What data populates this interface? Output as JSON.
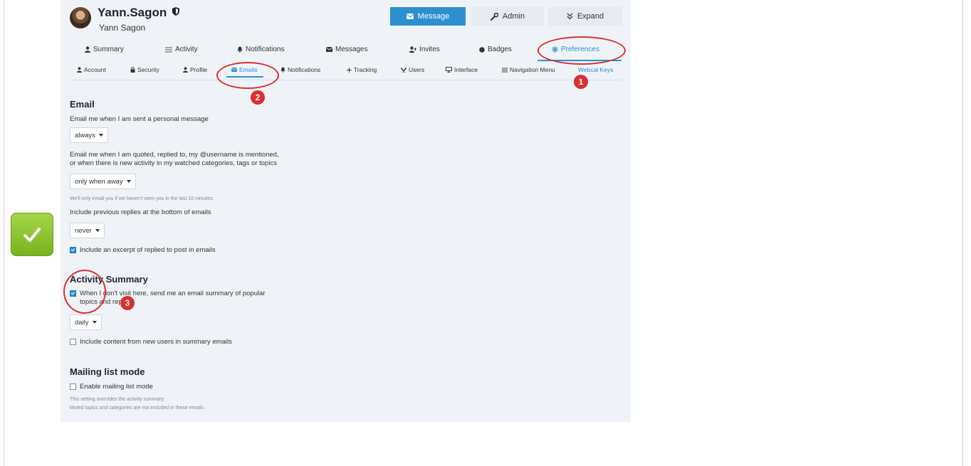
{
  "profile": {
    "username": "Yann.Sagon",
    "full_name": "Yann Sagon"
  },
  "header_buttons": {
    "message": "Message",
    "admin": "Admin",
    "expand": "Expand"
  },
  "tabs": [
    {
      "label": "Summary",
      "icon": "user-icon"
    },
    {
      "label": "Activity",
      "icon": "list-icon"
    },
    {
      "label": "Notifications",
      "icon": "bell-icon"
    },
    {
      "label": "Messages",
      "icon": "envelope-icon"
    },
    {
      "label": "Invites",
      "icon": "user-plus-icon"
    },
    {
      "label": "Badges",
      "icon": "badge-icon"
    },
    {
      "label": "Preferences",
      "icon": "gear-icon",
      "active": true
    }
  ],
  "subtabs": [
    {
      "label": "Account",
      "icon": "user-icon"
    },
    {
      "label": "Security",
      "icon": "lock-icon"
    },
    {
      "label": "Profile",
      "icon": "user-icon"
    },
    {
      "label": "Emails",
      "icon": "envelope-icon",
      "active": true
    },
    {
      "label": "Notifications",
      "icon": "bell-icon"
    },
    {
      "label": "Tracking",
      "icon": "plus-icon"
    },
    {
      "label": "Users",
      "icon": "users-icon"
    },
    {
      "label": "Interface",
      "icon": "desktop-icon"
    },
    {
      "label": "Navigation Menu",
      "icon": "bars-icon"
    },
    {
      "label": "Webcal Keys",
      "icon": ""
    }
  ],
  "email_section": {
    "title": "Email",
    "pm_label": "Email me when I am sent a personal message",
    "pm_value": "always",
    "activity_label_line1": "Email me when I am quoted, replied to, my @username is mentioned,",
    "activity_label_line2": "or when there is new activity in my watched categories, tags or topics",
    "activity_value": "only when away",
    "activity_hint": "We'll only email you if we haven't seen you in the last 10 minutes.",
    "previous_replies_label": "Include previous replies at the bottom of emails",
    "previous_replies_value": "never",
    "excerpt_label": "Include an excerpt of replied to post in emails",
    "excerpt_checked": true
  },
  "summary_section": {
    "title": "Activity Summary",
    "digest_label_line1": "When I don't visit here, send me an email summary of popular",
    "digest_label_line2": "topics and replies",
    "digest_checked": true,
    "digest_frequency": "daily",
    "new_users_label": "Include content from new users in summary emails",
    "new_users_checked": false
  },
  "mailing_section": {
    "title": "Mailing list mode",
    "enable_label": "Enable mailing list mode",
    "enable_checked": false,
    "hint_line1": "This setting overrides the activity summary.",
    "hint_line2": "Muted topics and categories are not included in these emails."
  },
  "annotations": [
    "1",
    "2",
    "3"
  ],
  "colors": {
    "accent": "#2d8fd0",
    "annotation_red": "#d9302f",
    "panel_bg": "#eff3f8",
    "check_badge_green": "#8cc63f"
  }
}
